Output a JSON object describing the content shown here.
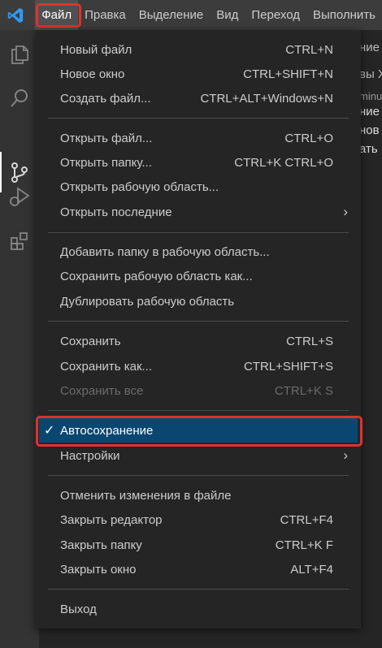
{
  "menubar": {
    "items": [
      {
        "label": "Файл"
      },
      {
        "label": "Правка"
      },
      {
        "label": "Выделение"
      },
      {
        "label": "Вид"
      },
      {
        "label": "Переход"
      },
      {
        "label": "Выполнить"
      }
    ]
  },
  "sidebar_text": {
    "line1": "ние",
    "line2": "вы X",
    "line3": "minu",
    "line4": "ние",
    "line5": "нов",
    "line6": "ать"
  },
  "file_menu": {
    "new_file": {
      "label": "Новый файл",
      "shortcut": "CTRL+N"
    },
    "new_window": {
      "label": "Новое окно",
      "shortcut": "CTRL+SHIFT+N"
    },
    "create_file": {
      "label": "Создать файл...",
      "shortcut": "CTRL+ALT+Windows+N"
    },
    "open_file": {
      "label": "Открыть файл...",
      "shortcut": "CTRL+O"
    },
    "open_folder": {
      "label": "Открыть папку...",
      "shortcut": "CTRL+K CTRL+O"
    },
    "open_workspace": {
      "label": "Открыть рабочую область..."
    },
    "open_recent": {
      "label": "Открыть последние"
    },
    "add_folder": {
      "label": "Добавить папку в рабочую область..."
    },
    "save_workspace_as": {
      "label": "Сохранить рабочую область как..."
    },
    "duplicate_workspace": {
      "label": "Дублировать рабочую область"
    },
    "save": {
      "label": "Сохранить",
      "shortcut": "CTRL+S"
    },
    "save_as": {
      "label": "Сохранить как...",
      "shortcut": "CTRL+SHIFT+S"
    },
    "save_all": {
      "label": "Сохранить все",
      "shortcut": "CTRL+K S"
    },
    "auto_save": {
      "label": "Автосохранение",
      "checkmark": "✓"
    },
    "preferences": {
      "label": "Настройки"
    },
    "revert_file": {
      "label": "Отменить изменения в файле"
    },
    "close_editor": {
      "label": "Закрыть редактор",
      "shortcut": "CTRL+F4"
    },
    "close_folder": {
      "label": "Закрыть папку",
      "shortcut": "CTRL+K F"
    },
    "close_window": {
      "label": "Закрыть окно",
      "shortcut": "ALT+F4"
    },
    "exit": {
      "label": "Выход"
    }
  },
  "icons": {
    "submenu": "chevron-right-icon"
  },
  "colors": {
    "highlight": "#e0312e",
    "selection": "#094771",
    "accent": "#0078d4"
  }
}
